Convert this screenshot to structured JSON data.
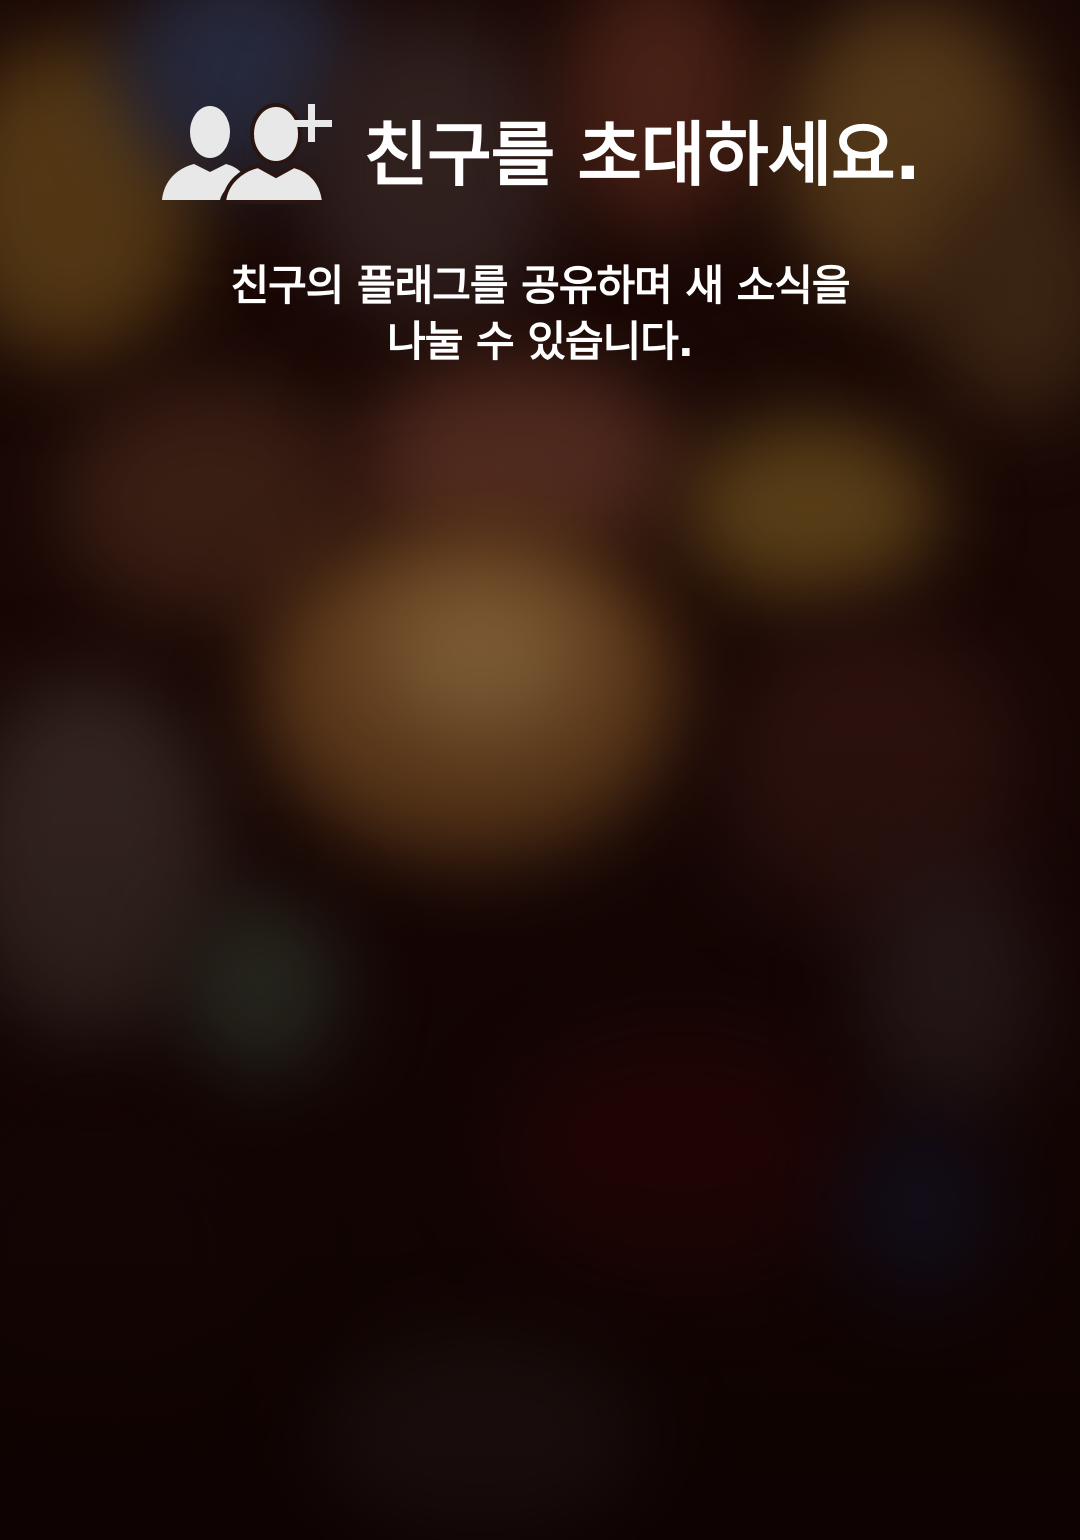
{
  "screen": {
    "title": "친구를 초대하세요.",
    "subtitle_line1": "친구의 플래그를 공유하며 새 소식을",
    "subtitle_line2": "나눌 수 있습니다.",
    "icon": "add-friends-icon"
  },
  "colors": {
    "text": "#ffffff",
    "icon": "#e8e8e8",
    "background": "#1a0805"
  }
}
